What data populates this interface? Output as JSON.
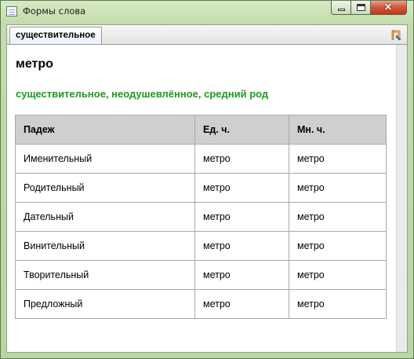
{
  "window": {
    "title": "Формы слова",
    "close_glyph": "✕"
  },
  "tab": {
    "label": "существительное",
    "action_icon": "edit-icon"
  },
  "word": {
    "lemma": "метро",
    "grammar": "существительное, неодушевлённое, средний род"
  },
  "table": {
    "headers": [
      "Падеж",
      "Ед. ч.",
      "Мн. ч."
    ],
    "rows": [
      [
        "Именительный",
        "метро",
        "метро"
      ],
      [
        "Родительный",
        "метро",
        "метро"
      ],
      [
        "Дательный",
        "метро",
        "метро"
      ],
      [
        "Винительный",
        "метро",
        "метро"
      ],
      [
        "Творительный",
        "метро",
        "метро"
      ],
      [
        "Предложный",
        "метро",
        "метро"
      ]
    ]
  },
  "colors": {
    "grammar_text": "#1c9b1c",
    "header_background": "#cfcfcf"
  }
}
